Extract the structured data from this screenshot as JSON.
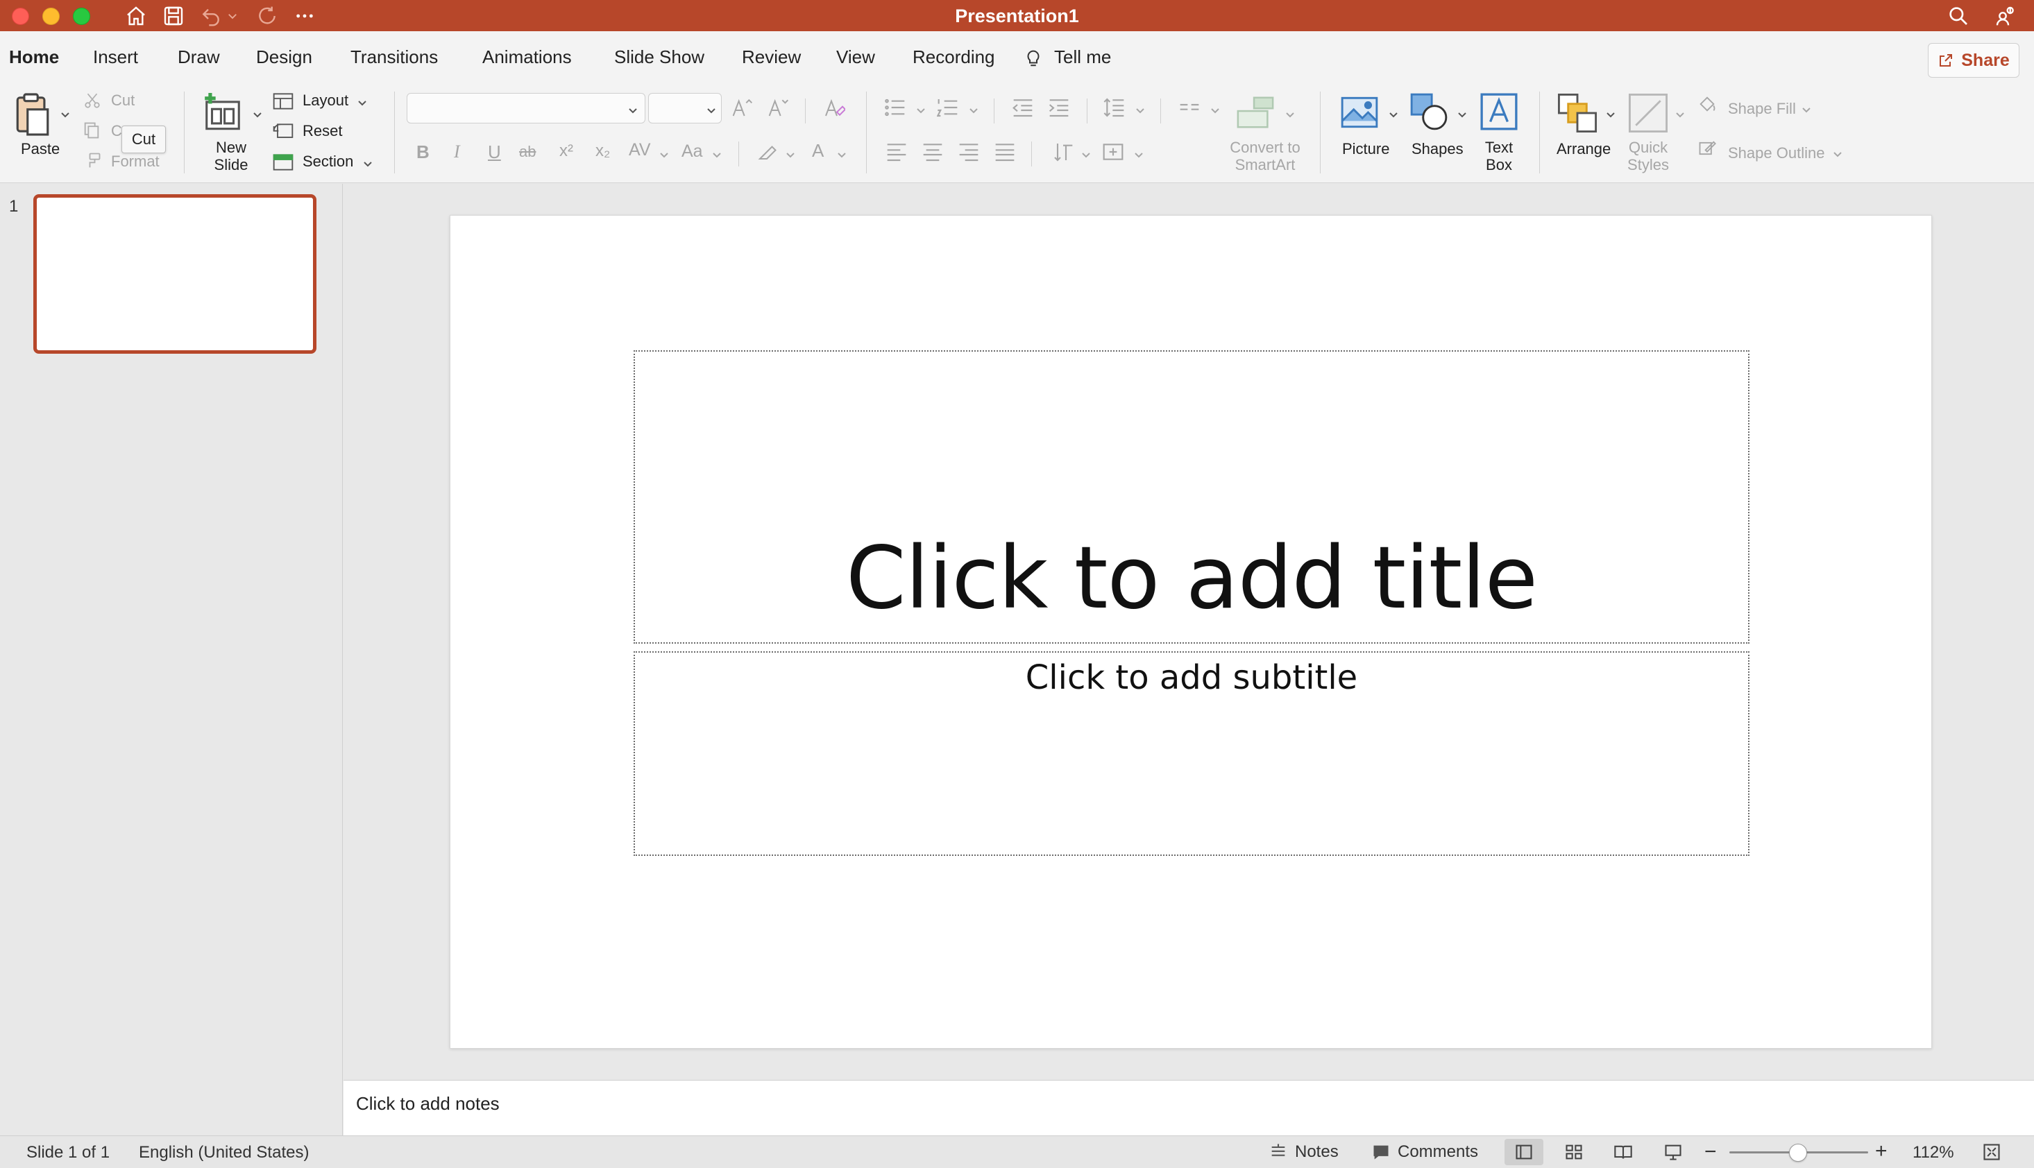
{
  "window": {
    "title": "Presentation1"
  },
  "tabs": [
    "Home",
    "Insert",
    "Draw",
    "Design",
    "Transitions",
    "Animations",
    "Slide Show",
    "Review",
    "View",
    "Recording"
  ],
  "tell_me": "Tell me",
  "share_label": "Share",
  "clipboard": {
    "paste": "Paste",
    "cut": "Cut",
    "copy": "C",
    "format": "Format",
    "tooltip": "Cut"
  },
  "slides_group": {
    "new_slide_line1": "New",
    "new_slide_line2": "Slide",
    "layout": "Layout",
    "reset": "Reset",
    "section": "Section"
  },
  "font": {
    "bold": "B",
    "italic": "I",
    "underline": "U",
    "strike": "ab",
    "superscript": "x²",
    "subscript": "x₂",
    "spacing": "AV",
    "case": "Aa",
    "color": "A"
  },
  "insert_group": {
    "smartart_line1": "Convert to",
    "smartart_line2": "SmartArt",
    "picture": "Picture",
    "shapes": "Shapes",
    "textbox_line1": "Text",
    "textbox_line2": "Box",
    "arrange": "Arrange",
    "quick_styles_line1": "Quick",
    "quick_styles_line2": "Styles",
    "shape_fill": "Shape Fill",
    "shape_outline": "Shape Outline"
  },
  "thumbnails": [
    {
      "number": "1"
    }
  ],
  "slide": {
    "title_placeholder": "Click to add title",
    "subtitle_placeholder": "Click to add subtitle"
  },
  "notes_placeholder": "Click to add notes",
  "status": {
    "slide_info": "Slide 1 of 1",
    "language": "English (United States)",
    "notes": "Notes",
    "comments": "Comments",
    "zoom": "112%"
  },
  "colors": {
    "accent": "#b7472a",
    "ribbon_bg": "#f3f3f3",
    "canvas_bg": "#e8e8e8"
  }
}
